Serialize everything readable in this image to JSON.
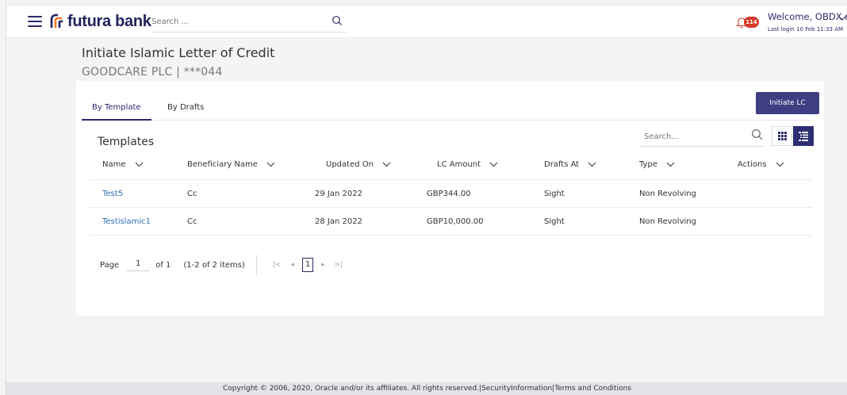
{
  "header": {
    "brand": "futura bank",
    "search_placeholder": "Search ...",
    "notification_count": "114",
    "welcome_text": "Welcome, OBDX maker",
    "last_login": "Last login 10 Feb 11:33 AM"
  },
  "page": {
    "title": "Initiate Islamic Letter of Credit",
    "subtitle": "GOODCARE PLC | ***044"
  },
  "tabs": [
    {
      "label": "By Template",
      "active": true
    },
    {
      "label": "By Drafts",
      "active": false
    }
  ],
  "actions": {
    "initiate_label": "Initiate LC"
  },
  "templates": {
    "heading": "Templates",
    "search_placeholder": "Search...",
    "columns": [
      "Name",
      "Beneficiary Name",
      "Updated On",
      "LC Amount",
      "Drafts At",
      "Type",
      "Actions"
    ],
    "rows": [
      {
        "name": "Test5",
        "beneficiary": "Cc",
        "updated_on": "29 Jan 2022",
        "amount": "GBP344.00",
        "drafts_at": "Sight",
        "type": "Non Revolving"
      },
      {
        "name": "Testislamic1",
        "beneficiary": "Cc",
        "updated_on": "28 Jan 2022",
        "amount": "GBP10,000.00",
        "drafts_at": "Sight",
        "type": "Non Revolving"
      }
    ]
  },
  "pagination": {
    "page_label": "Page",
    "page_value": "1",
    "of_label": "of 1",
    "items_label": "(1-2 of 2 items)",
    "current_page": "1"
  },
  "footer": {
    "copyright": "Copyright © 2006, 2020, Oracle and/or its affiliates. All rights reserved.|",
    "security_link": "SecurityInformation",
    "separator": "|",
    "terms_link": "Terms and Conditions"
  },
  "colors": {
    "brand": "#2b2b6a",
    "accent_button": "#3e3f83",
    "link": "#2f6fb5",
    "badge": "#d53a2a"
  },
  "icons": [
    "hamburger-icon",
    "search-icon",
    "bell-icon",
    "chevron-down-icon",
    "grid-view-icon",
    "list-view-icon"
  ]
}
